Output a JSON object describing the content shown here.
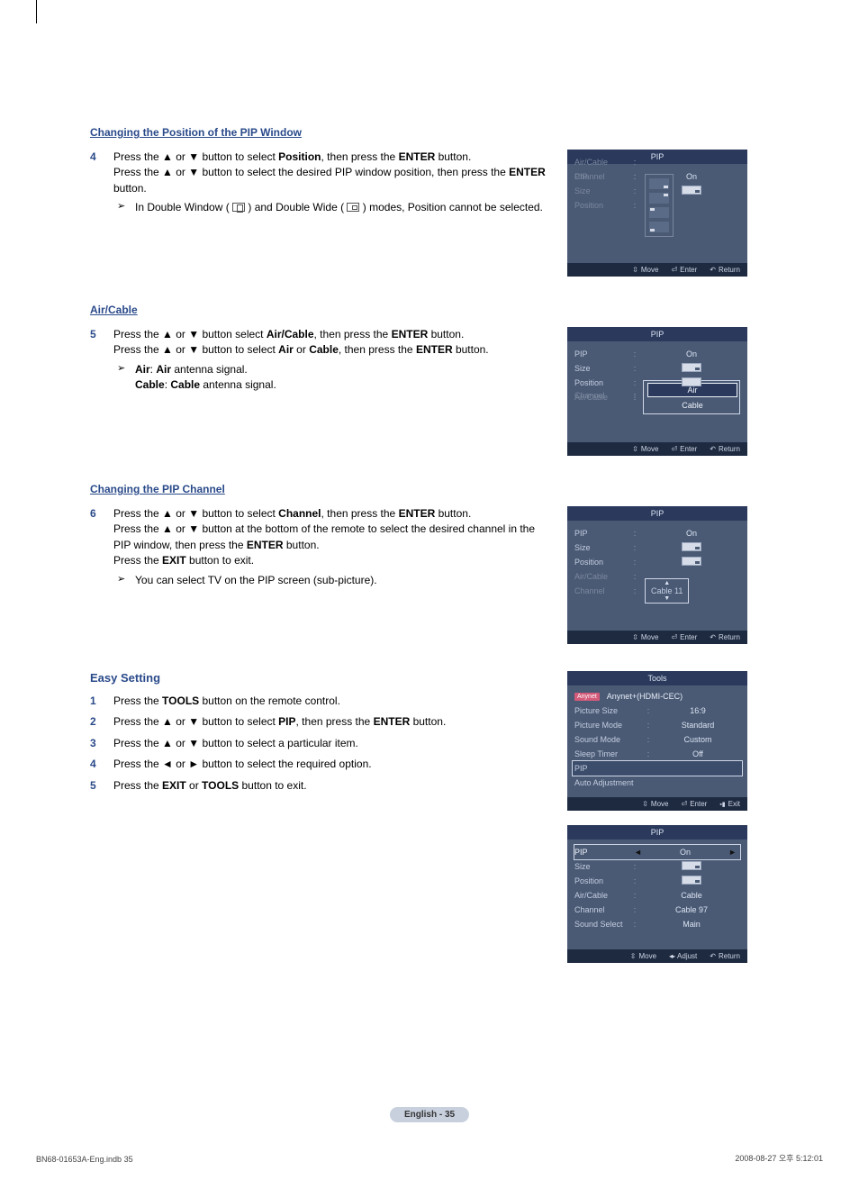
{
  "sections": {
    "position": {
      "heading": "Changing the Position of the PIP Window",
      "step4_num": "4",
      "step4_line1_a": "Press the ▲ or ▼ button to select ",
      "step4_bold1": "Position",
      "step4_line1_b": ", then press the ",
      "step4_bold2": "ENTER",
      "step4_line1_c": " button.",
      "step4_line2_a": "Press the ▲ or ▼ button to select the desired PIP window position, then press the ",
      "step4_bold3": "ENTER",
      "step4_line2_b": " button.",
      "note_a": "In Double Window ( ",
      "note_b": " ) and Double Wide ( ",
      "note_c": " ) modes, Position cannot be selected."
    },
    "aircable": {
      "heading": "Air/Cable",
      "step5_num": "5",
      "step5_line1_a": "Press the ▲ or ▼ button select ",
      "step5_bold1": "Air/Cable",
      "step5_line1_b": ", then press the ",
      "step5_bold2": "ENTER",
      "step5_line1_c": " button.",
      "step5_line2_a": "Press the ▲ or ▼ button to select ",
      "step5_bold3": "Air",
      "step5_line2_b": " or ",
      "step5_bold4": "Cable",
      "step5_line2_c": ", then press the ",
      "step5_bold5": "ENTER",
      "step5_line2_d": " button.",
      "bullet1_bold": "Air",
      "bullet1_sep": ": ",
      "bullet1_bold2": "Air",
      "bullet1_rest": " antenna signal.",
      "bullet2_bold": "Cable",
      "bullet2_sep": ": ",
      "bullet2_bold2": "Cable",
      "bullet2_rest": " antenna signal."
    },
    "channel": {
      "heading": "Changing the PIP Channel",
      "step6_num": "6",
      "line1_a": "Press the ▲ or ▼ button to select ",
      "bold1": "Channel",
      "line1_b": ", then press the ",
      "bold2": "ENTER",
      "line1_c": " button.",
      "line2_a": "Press the ▲ or ▼ button at the bottom of the remote to select the desired channel in the PIP window, then press the ",
      "bold3": "ENTER",
      "line2_b": " button.",
      "line3_a": "Press the ",
      "bold4": "EXIT",
      "line3_b": " button to exit.",
      "note": "You can select TV on the PIP screen (sub-picture)."
    },
    "easy": {
      "heading": "Easy Setting",
      "s1n": "1",
      "s1_a": "Press the ",
      "s1_b": "TOOLS",
      "s1_c": " button on the remote control.",
      "s2n": "2",
      "s2_a": "Press the ▲ or ▼ button to select ",
      "s2_b": "PIP",
      "s2_c": ", then press the ",
      "s2_d": "ENTER",
      "s2_e": " button.",
      "s3n": "3",
      "s3_a": "Press the ▲ or ▼ button to select a particular item.",
      "s4n": "4",
      "s4_a": "Press the ◄ or ► button to select the required option.",
      "s5n": "5",
      "s5_a": "Press the ",
      "s5_b": "EXIT",
      "s5_c": " or ",
      "s5_d": "TOOLS",
      "s5_e": " button to exit."
    }
  },
  "osd": {
    "pip_title": "PIP",
    "foot_move": "Move",
    "foot_enter": "Enter",
    "foot_return": "Return",
    "foot_adjust": "Adjust",
    "foot_exit": "Exit",
    "labels": {
      "pip": "PIP",
      "size": "Size",
      "position": "Position",
      "aircable": "Air/Cable",
      "channel": "Channel",
      "sound_select": "Sound Select"
    },
    "vals": {
      "on": "On",
      "air": "Air",
      "cable": "Cable",
      "cable11": "Cable 11",
      "cable97": "Cable 97",
      "main": "Main"
    },
    "tools_title": "Tools",
    "tools": {
      "anynet": "Anynet+(HDMI-CEC)",
      "picture_size": "Picture Size",
      "picture_size_v": "16:9",
      "picture_mode": "Picture Mode",
      "picture_mode_v": "Standard",
      "sound_mode": "Sound Mode",
      "sound_mode_v": "Custom",
      "sleep_timer": "Sleep Timer",
      "sleep_timer_v": "Off",
      "pip": "PIP",
      "auto_adj": "Auto Adjustment"
    }
  },
  "footer": {
    "pill": "English - 35",
    "indb": "BN68-01653A-Eng.indb   35",
    "date": "2008-08-27   오후 5:12:01"
  }
}
